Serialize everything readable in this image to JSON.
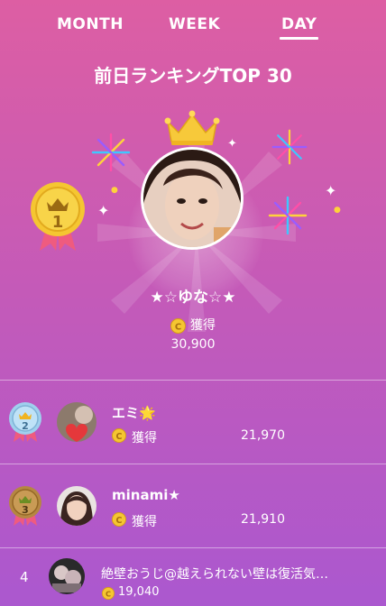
{
  "tabs": [
    {
      "label": "MONTH",
      "active": false
    },
    {
      "label": "WEEK",
      "active": false
    },
    {
      "label": "DAY",
      "active": true
    }
  ],
  "title": "前日ランキングTOP 30",
  "top": {
    "rank": "1",
    "name": "★☆ゆな☆★",
    "earn_label": "獲得",
    "points": "30,900"
  },
  "ranking": [
    {
      "rank": "2",
      "name": "エミ🌟",
      "earn_label": "獲得",
      "points": "21,970"
    },
    {
      "rank": "3",
      "name": "minami★",
      "earn_label": "獲得",
      "points": "21,910"
    },
    {
      "rank": "4",
      "name": "絶壁おうじ@越えられない壁は復活気…",
      "points": "19,040"
    }
  ],
  "colors": {
    "bg_top": "#dd5ea3",
    "bg_bottom": "#ab58cf",
    "gold": "#f5c631",
    "silver": "#9fd0ee",
    "bronze": "#b58742"
  }
}
